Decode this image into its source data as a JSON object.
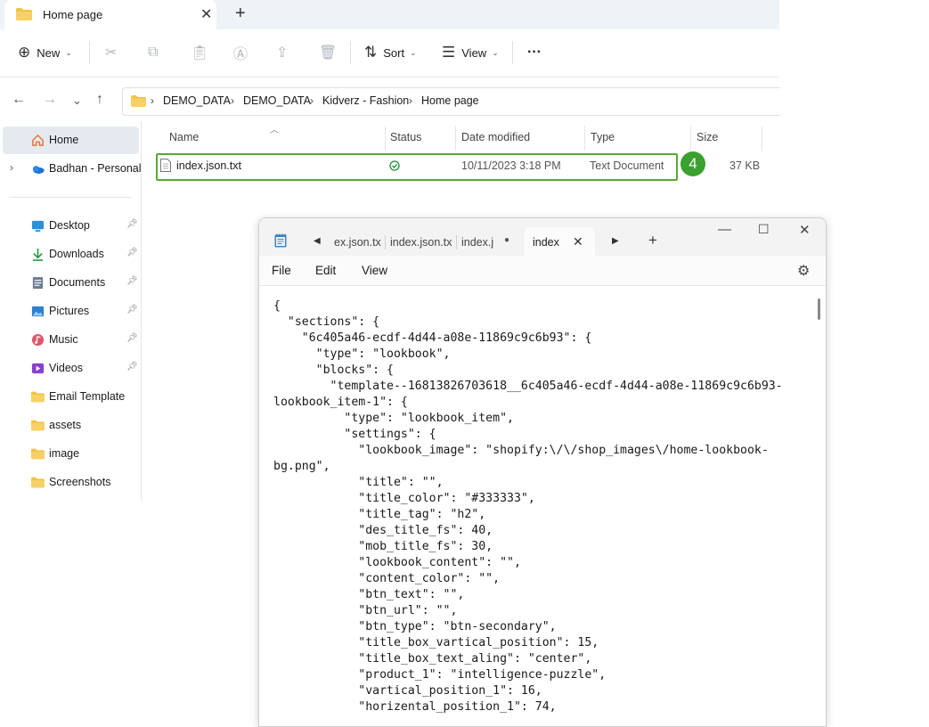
{
  "window": {
    "tab_title": "Home page",
    "tab_close": "✕",
    "new_tab": "+"
  },
  "toolbar": {
    "new_label": "New",
    "sort_label": "Sort",
    "view_label": "View",
    "more_label": "···"
  },
  "address": {
    "crumbs": [
      "DEMO_DATA",
      "DEMO_DATA",
      "Kidverz - Fashion",
      "Home page"
    ]
  },
  "sidebar": {
    "items": [
      {
        "label": "Home",
        "icon": "home-icon"
      },
      {
        "label": "Badhan - Personal",
        "icon": "onedrive-icon"
      },
      {
        "label": "Desktop",
        "icon": "desktop-icon"
      },
      {
        "label": "Downloads",
        "icon": "download-icon"
      },
      {
        "label": "Documents",
        "icon": "documents-icon"
      },
      {
        "label": "Pictures",
        "icon": "pictures-icon"
      },
      {
        "label": "Music",
        "icon": "music-icon"
      },
      {
        "label": "Videos",
        "icon": "videos-icon"
      },
      {
        "label": "Email Template",
        "icon": "folder-icon"
      },
      {
        "label": "assets",
        "icon": "folder-icon"
      },
      {
        "label": "image",
        "icon": "folder-icon"
      },
      {
        "label": "Screenshots",
        "icon": "folder-icon"
      }
    ]
  },
  "filelist": {
    "columns": [
      "Name",
      "Status",
      "Date modified",
      "Type",
      "Size"
    ],
    "rows": [
      {
        "name": "index.json.txt",
        "date": "10/11/2023 3:18 PM",
        "type": "Text Document",
        "size": "37 KB"
      }
    ],
    "step_badge": "4"
  },
  "notepad": {
    "tabs": [
      "ex.json.tx",
      "index.json.tx",
      "index.j",
      "index"
    ],
    "menu": [
      "File",
      "Edit",
      "View"
    ],
    "content": "{\n  \"sections\": {\n    \"6c405a46-ecdf-4d44-a08e-11869c9c6b93\": {\n      \"type\": \"lookbook\",\n      \"blocks\": {\n        \"template--16813826703618__6c405a46-ecdf-4d44-a08e-11869c9c6b93-\nlookbook_item-1\": {\n          \"type\": \"lookbook_item\",\n          \"settings\": {\n            \"lookbook_image\": \"shopify:\\/\\/shop_images\\/home-lookbook-\nbg.png\",\n            \"title\": \"\",\n            \"title_color\": \"#333333\",\n            \"title_tag\": \"h2\",\n            \"des_title_fs\": 40,\n            \"mob_title_fs\": 30,\n            \"lookbook_content\": \"\",\n            \"content_color\": \"\",\n            \"btn_text\": \"\",\n            \"btn_url\": \"\",\n            \"btn_type\": \"btn-secondary\",\n            \"title_box_vartical_position\": 15,\n            \"title_box_text_aling\": \"center\",\n            \"product_1\": \"intelligence-puzzle\",\n            \"vartical_position_1\": 16,\n            \"horizental_position_1\": 74,"
  },
  "colors": {
    "accent_green": "#3aa02f",
    "highlight_border": "#5aa832",
    "folder_yellow": "#f3c344"
  }
}
